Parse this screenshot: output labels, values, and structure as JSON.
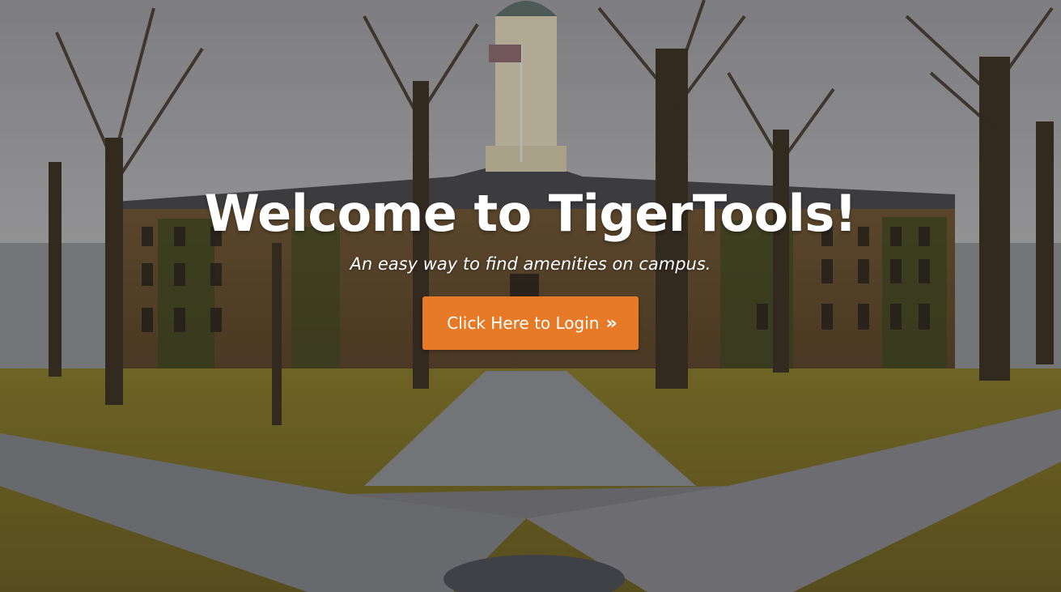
{
  "hero": {
    "title": "Welcome to TigerTools!",
    "subtitle": "An easy way to find amenities on campus.",
    "login_button": {
      "label": "Click Here to Login",
      "icon": "double-chevron-right-icon",
      "icon_glyph": "»"
    }
  },
  "colors": {
    "accent": "#e67a27",
    "title_text": "#ffffff",
    "button_text": "#ffffff"
  },
  "background": {
    "scene": "campus-building-with-trees-photo"
  }
}
